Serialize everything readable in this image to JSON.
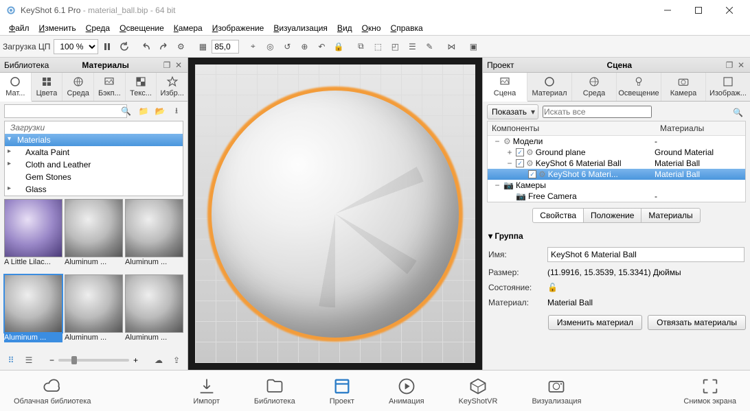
{
  "titlebar": {
    "app": "KeyShot 6.1 Pro",
    "file": "material_ball.bip",
    "bits": "64 bit"
  },
  "menu": [
    "Файл",
    "Изменить",
    "Среда",
    "Освещение",
    "Камера",
    "Изображение",
    "Визуализация",
    "Вид",
    "Окно",
    "Справка"
  ],
  "toolbar": {
    "cpu_label": "Загрузка ЦП",
    "cpu_value": "100 %",
    "frame": "85,0"
  },
  "library": {
    "panel_title_left": "Библиотека",
    "panel_title_center": "Материалы",
    "tabs": [
      "Мат...",
      "Цвета",
      "Среда",
      "Бэкп...",
      "Текс...",
      "Избр..."
    ],
    "search_placeholder": "",
    "tree_header": "Загрузки",
    "tree": [
      "Materials",
      "Axalta Paint",
      "Cloth and Leather",
      "Gem Stones",
      "Glass"
    ],
    "thumbs": [
      "A Little Lilac...",
      "Aluminum ...",
      "Aluminum ...",
      "Aluminum ...",
      "Aluminum ...",
      "Aluminum ..."
    ]
  },
  "project": {
    "panel_title_left": "Проект",
    "panel_title_center": "Сцена",
    "tabs": [
      "Сцена",
      "Материал",
      "Среда",
      "Освещение",
      "Камера",
      "Изображ..."
    ],
    "show_label": "Показать",
    "search_placeholder": "Искать все",
    "cols": [
      "Компоненты",
      "Материалы"
    ],
    "rows": [
      {
        "indent": 0,
        "exp": "−",
        "chk": false,
        "icon": "model",
        "name": "Модели",
        "mat": "-"
      },
      {
        "indent": 1,
        "exp": "+",
        "chk": true,
        "icon": "model",
        "name": "Ground plane",
        "mat": "Ground Material"
      },
      {
        "indent": 1,
        "exp": "−",
        "chk": true,
        "icon": "model",
        "name": "KeyShot 6 Material Ball",
        "mat": "Material Ball"
      },
      {
        "indent": 2,
        "exp": "",
        "chk": true,
        "icon": "model",
        "name": "KeyShot 6 Materi...",
        "mat": "Material Ball",
        "sel": true
      },
      {
        "indent": 0,
        "exp": "−",
        "chk": false,
        "icon": "cam",
        "name": "Камеры",
        "mat": ""
      },
      {
        "indent": 1,
        "exp": "",
        "chk": false,
        "icon": "cam",
        "name": "Free Camera",
        "mat": "-"
      }
    ],
    "sub_tabs": [
      "Свойства",
      "Положение",
      "Материалы"
    ],
    "group_label": "Группа",
    "props": {
      "name_label": "Имя:",
      "name_value": "KeyShot 6 Material Ball",
      "size_label": "Размер:",
      "size_value": "(11.9916, 15.3539, 15.3341) Дюймы",
      "state_label": "Состояние:",
      "material_label": "Материал:",
      "material_value": "Material Ball"
    },
    "buttons": [
      "Изменить материал",
      "Отвязать материалы"
    ]
  },
  "bottom": {
    "cloud": "Облачная библиотека",
    "import": "Импорт",
    "library": "Библиотека",
    "project": "Проект",
    "animation": "Анимация",
    "vr": "KeyShotVR",
    "render": "Визуализация",
    "screenshot": "Снимок экрана"
  }
}
